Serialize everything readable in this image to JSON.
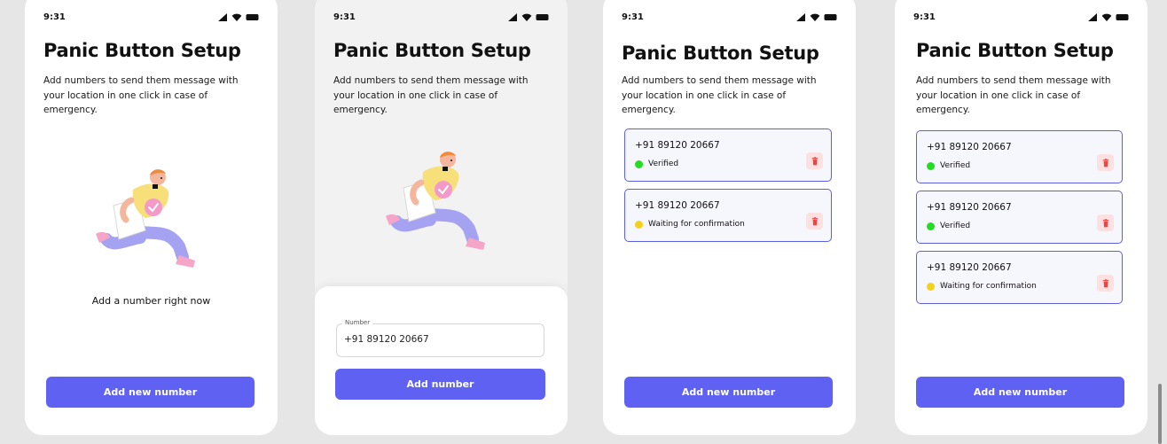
{
  "status": {
    "time": "9:31"
  },
  "icons": {
    "signal": "signal-icon",
    "wifi": "wifi-icon",
    "battery": "battery-icon",
    "delete": "trash-icon"
  },
  "colors": {
    "accent": "#5f61f3",
    "card_border": "#5b5fe0",
    "verified": "#22dd22",
    "waiting": "#f4d21c",
    "delete_bg": "#fde0e0",
    "delete_icon": "#ef4444"
  },
  "screens": [
    {
      "title": "Panic Button Setup",
      "description": "Add numbers to send them message with your location in one click in case of emergency.",
      "empty_text": "Add a number right now",
      "primary_button": "Add new number"
    },
    {
      "title": "Panic Button Setup",
      "description": "Add numbers to send them message with your location in one click in case of emergency.",
      "field_label": "Number",
      "field_value": "+91 89120 20667",
      "primary_button": "Add number"
    },
    {
      "title": "Panic Button Setup",
      "description": "Add numbers to send them message with your location in one click in case of emergency.",
      "cards": [
        {
          "number": "+91 89120 20667",
          "status": "Verified",
          "status_color": "#22dd22"
        },
        {
          "number": "+91 89120 20667",
          "status": "Waiting for confirmation",
          "status_color": "#f4d21c"
        }
      ],
      "primary_button": "Add new number"
    },
    {
      "title": "Panic Button Setup",
      "description": "Add numbers to send them message with your location in one click in case of emergency.",
      "cards": [
        {
          "number": "+91 89120 20667",
          "status": "Verified",
          "status_color": "#22dd22"
        },
        {
          "number": "+91 89120 20667",
          "status": "Verified",
          "status_color": "#22dd22"
        },
        {
          "number": "+91 89120 20667",
          "status": "Waiting for confirmation",
          "status_color": "#f4d21c"
        }
      ],
      "primary_button": "Add new number"
    }
  ]
}
